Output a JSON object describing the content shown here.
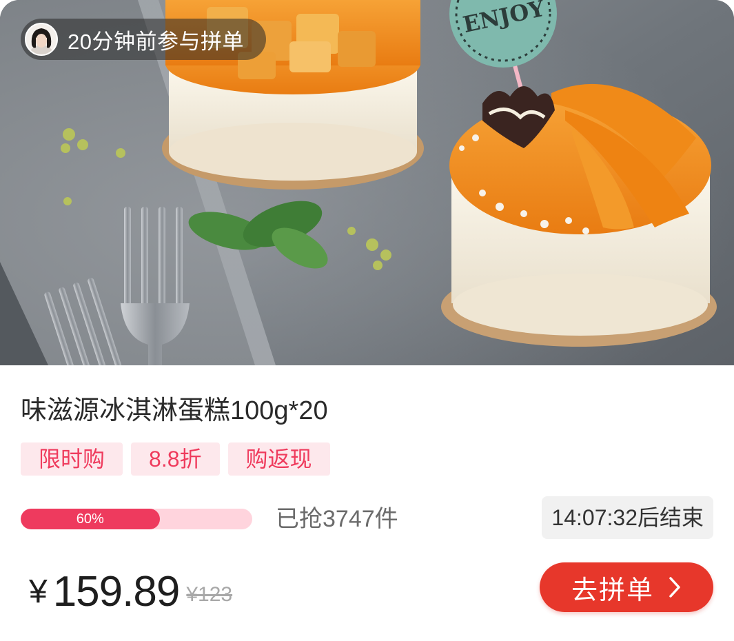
{
  "joiner": {
    "avatar_icon": "user-avatar",
    "text": "20分钟前参与拼单"
  },
  "product": {
    "title": "味滋源冰淇淋蛋糕100g*20",
    "image_topper_text": "ENJOY",
    "tags": [
      "限时购",
      "8.8折",
      "购返现"
    ]
  },
  "sales": {
    "progress_percent": 60,
    "progress_label": "60%",
    "sold_text": "已抢3747件",
    "countdown_text": "14:07:32后结束"
  },
  "price": {
    "currency": "¥",
    "current": "159.89",
    "original": "¥123"
  },
  "cta": {
    "label": "去拼单",
    "icon": "chevron-right-icon"
  },
  "colors": {
    "accent_red": "#e7372b",
    "tag_text": "#ef3b5d",
    "tag_bg": "#fde8ec",
    "progress_fill": "#ee3a5e",
    "progress_track": "#ffd4dd"
  }
}
